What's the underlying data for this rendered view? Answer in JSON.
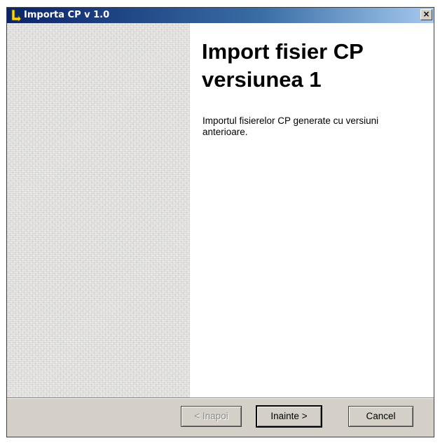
{
  "window": {
    "title": "Importa CP v 1.0",
    "icon": "wizard-arrow-icon",
    "close_label": "×"
  },
  "colors": {
    "titlebar_start": "#0a246a",
    "titlebar_end": "#a6caf0",
    "icon": "#ffd800",
    "face": "#d4d0c8"
  },
  "content": {
    "heading": "Import fisier CP versiunea 1",
    "description": "Importul fisierelor CP generate cu versiuni anterioare."
  },
  "buttons": {
    "back_label": "< Inapoi",
    "back_enabled": false,
    "next_label": "Inainte >",
    "cancel_label": "Cancel"
  }
}
